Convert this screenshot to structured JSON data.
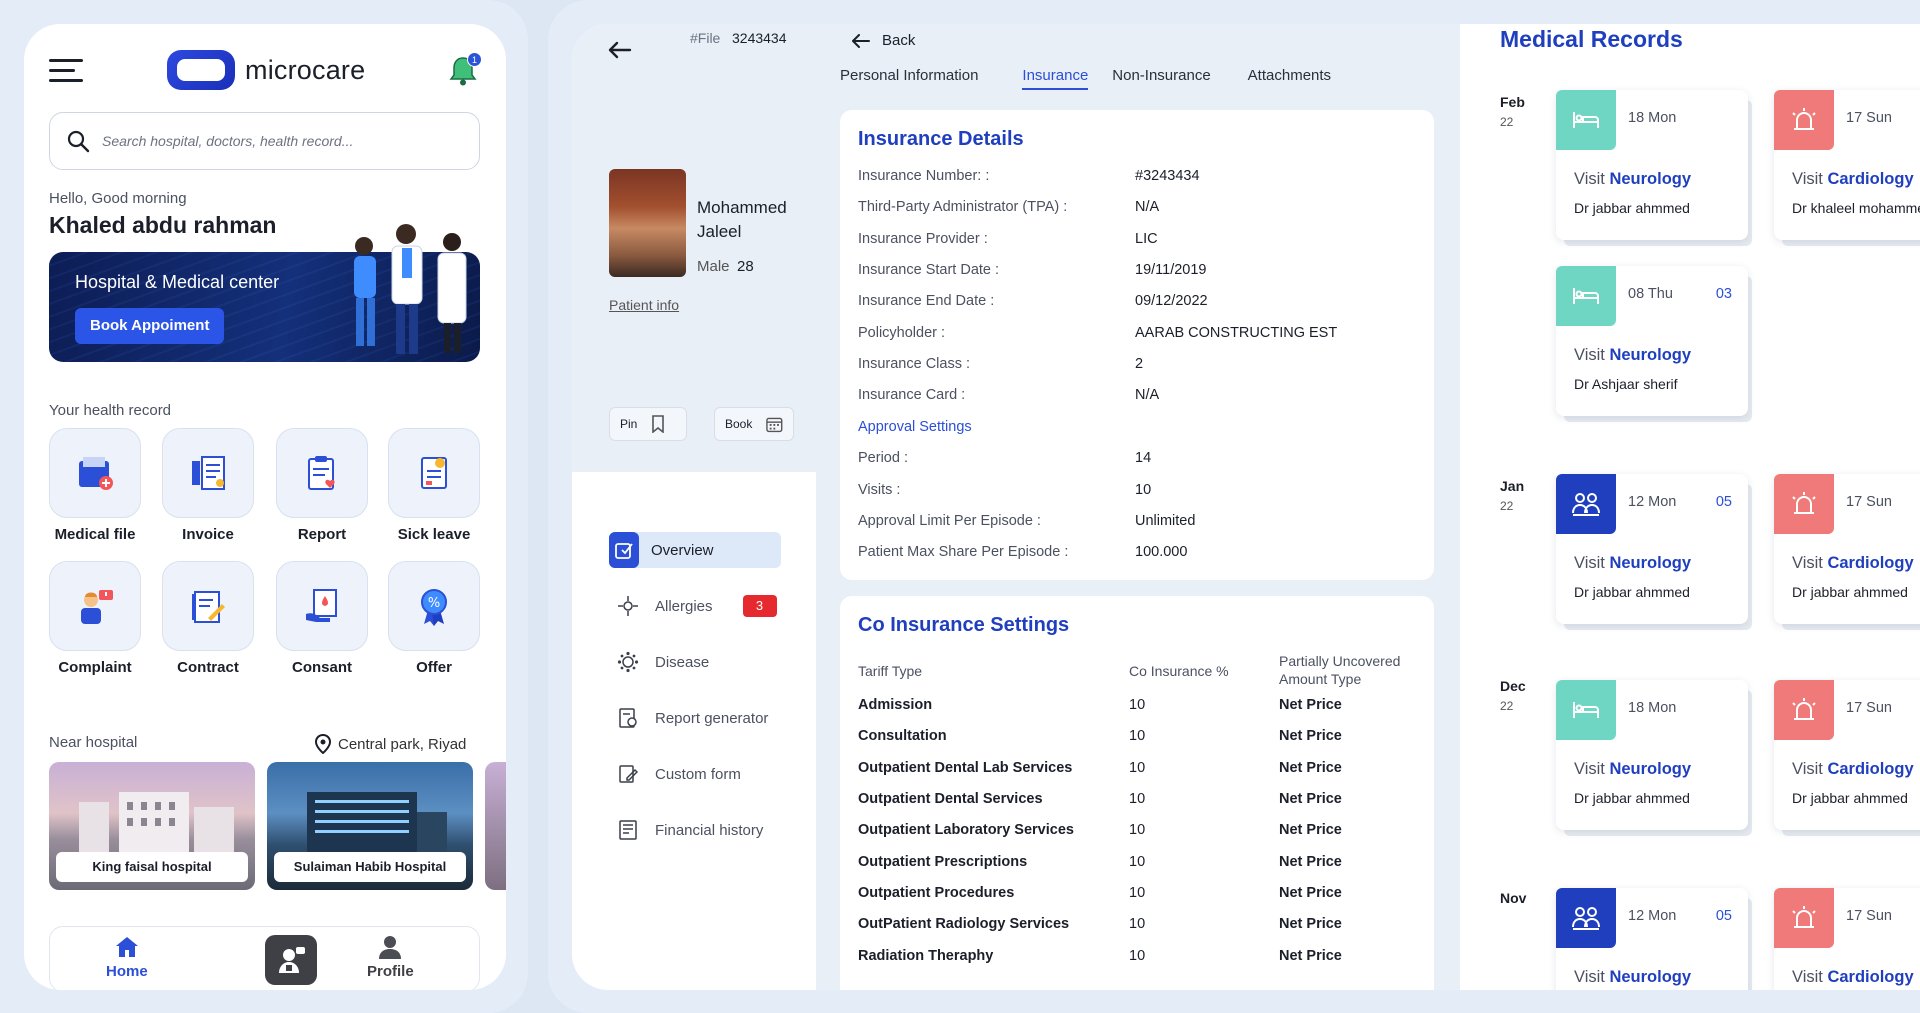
{
  "phone": {
    "logo_text": "microcare",
    "notification_count": "1",
    "search_placeholder": "Search hospital, doctors, health record...",
    "greeting": "Hello, Good morning",
    "user_name": "Khaled abdu rahman",
    "banner_title": "Hospital & Medical center",
    "banner_button": "Book Appoiment",
    "health_record_label": "Your health record",
    "tiles": [
      {
        "label": "Medical file",
        "icon": "medical-file-icon"
      },
      {
        "label": "Invoice",
        "icon": "invoice-icon"
      },
      {
        "label": "Report",
        "icon": "report-icon"
      },
      {
        "label": "Sick leave",
        "icon": "sick-leave-icon"
      },
      {
        "label": "Complaint",
        "icon": "complaint-icon"
      },
      {
        "label": "Contract",
        "icon": "contract-icon"
      },
      {
        "label": "Consant",
        "icon": "consent-icon"
      },
      {
        "label": "Offer",
        "icon": "offer-icon"
      }
    ],
    "near_hospital_label": "Near hospital",
    "location": "Central park, Riyad",
    "hospitals": [
      {
        "name": "King faisal hospital"
      },
      {
        "name": "Sulaiman Habib Hospital"
      }
    ],
    "nav": {
      "home": "Home",
      "profile": "Profile"
    }
  },
  "tablet": {
    "file_label": "#File",
    "file_number": "3243434",
    "patient": {
      "name": "Mohammed Jaleel",
      "gender": "Male",
      "age": "28",
      "info_link": "Patient info"
    },
    "pin_label": "Pin",
    "book_label": "Book",
    "sidebar": [
      {
        "label": "Overview",
        "icon": "overview-icon"
      },
      {
        "label": "Allergies",
        "icon": "allergies-icon",
        "badge": "3"
      },
      {
        "label": "Disease",
        "icon": "disease-icon"
      },
      {
        "label": "Report generator",
        "icon": "report-generator-icon"
      },
      {
        "label": "Custom form",
        "icon": "custom-form-icon"
      },
      {
        "label": "Financial history",
        "icon": "financial-history-icon"
      }
    ],
    "back_label": "Back",
    "tabs": [
      "Personal Information",
      "Insurance",
      "Non-Insurance",
      "Attachments"
    ],
    "active_tab": "Insurance",
    "insurance": {
      "title": "Insurance Details",
      "rows": [
        {
          "key": "Insurance Number: :",
          "value": "#3243434"
        },
        {
          "key": "Third-Party Administrator (TPA) :",
          "value": "N/A"
        },
        {
          "key": "Insurance Provider :",
          "value": "LIC"
        },
        {
          "key": "Insurance Start Date :",
          "value": "19/11/2019"
        },
        {
          "key": "Insurance End Date :",
          "value": "09/12/2022"
        },
        {
          "key": "Policyholder :",
          "value": "AARAB CONSTRUCTING EST"
        },
        {
          "key": "Insurance Class :",
          "value": "2"
        },
        {
          "key": "Insurance Card :",
          "value": "N/A"
        }
      ],
      "approval_title": "Approval Settings",
      "approval_rows": [
        {
          "key": "Period :",
          "value": "14"
        },
        {
          "key": "Visits :",
          "value": "10"
        },
        {
          "key": "Approval Limit Per Episode :",
          "value": "Unlimited"
        },
        {
          "key": "Patient Max Share Per Episode :",
          "value": "100.000"
        }
      ]
    },
    "co_insurance": {
      "title": "Co Insurance Settings",
      "headers": [
        "Tariff Type",
        "Co Insurance %",
        "Partially Uncovered Amount Type"
      ],
      "rows": [
        {
          "type": "Admission",
          "pct": "10",
          "amount": "Net Price"
        },
        {
          "type": "Consultation",
          "pct": "10",
          "amount": "Net Price"
        },
        {
          "type": "Outpatient Dental Lab Services",
          "pct": "10",
          "amount": "Net Price"
        },
        {
          "type": "Outpatient Dental Services",
          "pct": "10",
          "amount": "Net Price"
        },
        {
          "type": "Outpatient Laboratory Services",
          "pct": "10",
          "amount": "Net Price"
        },
        {
          "type": "Outpatient Prescriptions",
          "pct": "10",
          "amount": "Net Price"
        },
        {
          "type": "Outpatient Procedures",
          "pct": "10",
          "amount": "Net Price"
        },
        {
          "type": "OutPatient Radiology Services",
          "pct": "10",
          "amount": "Net Price"
        },
        {
          "type": "Radiation Theraphy",
          "pct": "10",
          "amount": "Net Price"
        }
      ]
    },
    "records": {
      "title": "Medical Records",
      "months": [
        {
          "month": "Feb",
          "year": "22"
        },
        {
          "month": "Jan",
          "year": "22"
        },
        {
          "month": "Dec",
          "year": "22"
        },
        {
          "month": "Nov",
          "year": ""
        }
      ],
      "visit_prefix": "Visit",
      "cards": [
        {
          "date": "18 Mon",
          "num": "",
          "dept": "Neurology",
          "doctor": "Dr jabbar ahmmed",
          "color": "#6fd6c3",
          "icon": "bed-icon"
        },
        {
          "date": "17 Sun",
          "num": "",
          "dept": "Cardiology",
          "doctor": "Dr khaleel mohammed",
          "color": "#f07a7a",
          "icon": "emergency-icon"
        },
        {
          "date": "08 Thu",
          "num": "03",
          "dept": "Neurology",
          "doctor": "Dr Ashjaar sherif",
          "color": "#6fd6c3",
          "icon": "bed-icon"
        },
        {
          "date": "12 Mon",
          "num": "05",
          "dept": "Neurology",
          "doctor": "Dr jabbar ahmmed",
          "color": "#1f3fbf",
          "icon": "consult-icon"
        },
        {
          "date": "17 Sun",
          "num": "",
          "dept": "Cardiology",
          "doctor": "Dr jabbar ahmmed",
          "color": "#f07a7a",
          "icon": "emergency-icon"
        },
        {
          "date": "18 Mon",
          "num": "",
          "dept": "Neurology",
          "doctor": "Dr jabbar ahmmed",
          "color": "#6fd6c3",
          "icon": "bed-icon"
        },
        {
          "date": "17 Sun",
          "num": "",
          "dept": "Cardiology",
          "doctor": "Dr jabbar ahmmed",
          "color": "#f07a7a",
          "icon": "emergency-icon"
        },
        {
          "date": "12 Mon",
          "num": "05",
          "dept": "Neurology",
          "doctor": "",
          "color": "#1f3fbf",
          "icon": "consult-icon"
        },
        {
          "date": "17 Sun",
          "num": "",
          "dept": "Cardiology",
          "doctor": "",
          "color": "#f07a7a",
          "icon": "emergency-icon"
        }
      ]
    }
  }
}
